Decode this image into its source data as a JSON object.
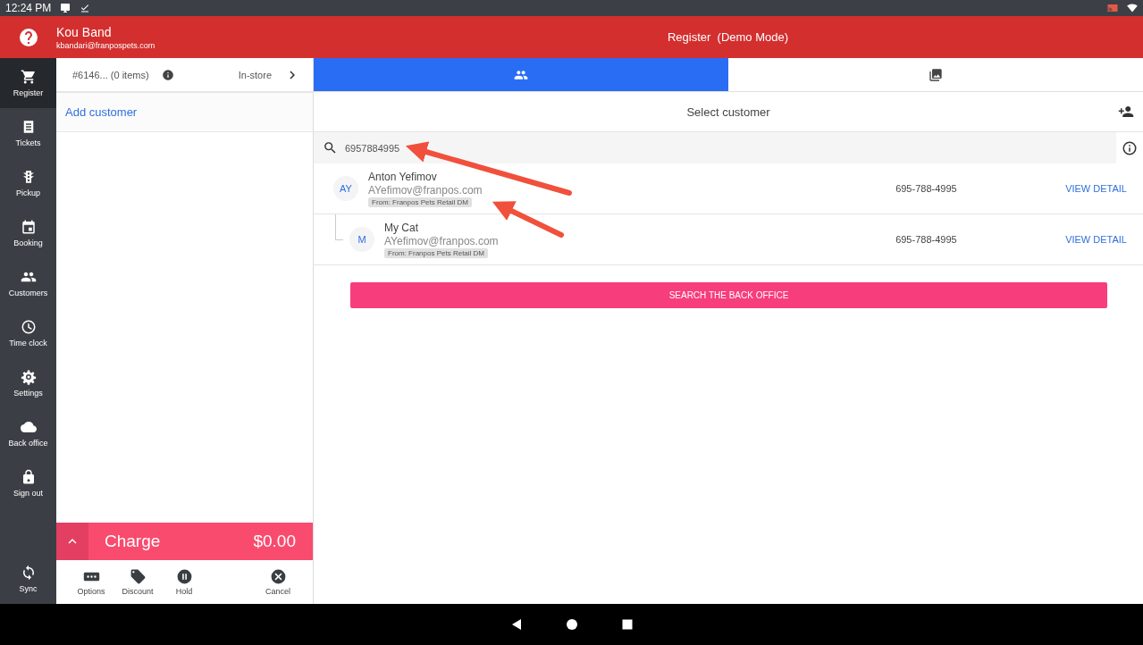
{
  "status_bar": {
    "time": "12:24 PM"
  },
  "header": {
    "user_name": "Kou Band",
    "user_email": "kbandari@franpospets.com",
    "title": "Register  (Demo Mode)"
  },
  "sidebar": {
    "items": [
      {
        "label": "Register",
        "selected": true
      },
      {
        "label": "Tickets",
        "selected": false
      },
      {
        "label": "Pickup",
        "selected": false
      },
      {
        "label": "Booking",
        "selected": false
      },
      {
        "label": "Customers",
        "selected": false
      },
      {
        "label": "Time clock",
        "selected": false
      },
      {
        "label": "Settings",
        "selected": false
      },
      {
        "label": "Back office",
        "selected": false
      },
      {
        "label": "Sign out",
        "selected": false
      }
    ],
    "footer_item": {
      "label": "Sync"
    }
  },
  "cart": {
    "order": "#6146... (0 items)",
    "channel": "In-store",
    "add_customer": "Add customer",
    "charge_label": "Charge",
    "charge_amount": "$0.00",
    "actions": [
      {
        "label": "Options"
      },
      {
        "label": "Discount"
      },
      {
        "label": "Hold"
      },
      {
        "label": "Cancel"
      }
    ]
  },
  "customer_panel": {
    "tabs": [
      {
        "kind": "people",
        "selected": true
      },
      {
        "kind": "photos",
        "selected": false
      }
    ],
    "title": "Select customer",
    "search": {
      "value": "6957884995"
    },
    "results": [
      {
        "initials": "AY",
        "name": "Anton Yefimov",
        "email": "AYefimov@franpos.com",
        "source": "From: Franpos Pets Retail DM",
        "phone": "695-788-4995",
        "action": "VIEW DETAIL",
        "children": [
          {
            "initials": "M",
            "name": "My Cat",
            "email": "AYefimov@franpos.com",
            "source": "From: Franpos Pets Retail DM",
            "phone": "695-788-4995",
            "action": "VIEW DETAIL"
          }
        ]
      }
    ],
    "back_office_button": "SEARCH THE BACK OFFICE"
  }
}
